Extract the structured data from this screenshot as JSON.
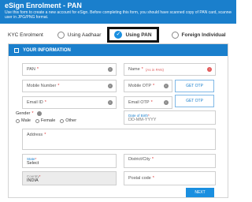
{
  "header": {
    "title": "eSign Enrolment - PAN",
    "subtitle_line1": "Use this form to create a new account for eSign. Before completing this form, you should have scanned copy of PAN card, scanned",
    "subtitle_line2": "user in JPG/PNG format."
  },
  "kyc": {
    "label": "KYC Enrolment",
    "options": [
      {
        "label": "Using Aadhaar",
        "selected": false
      },
      {
        "label": "Using PAN",
        "selected": true
      },
      {
        "label": "Foreign Individual",
        "selected": false
      }
    ]
  },
  "panel": {
    "title": "YOUR INFORMATION",
    "pan": {
      "label": "PAN",
      "req": "*"
    },
    "name": {
      "label": "Name",
      "req": "*",
      "note": "(As in PAN)"
    },
    "mobile": {
      "label": "Mobile Number",
      "req": "*"
    },
    "mobile_otp": {
      "label": "Mobile OTP",
      "req": "*"
    },
    "email": {
      "label": "Email ID",
      "req": "*"
    },
    "email_otp": {
      "label": "Email OTP",
      "req": "*"
    },
    "get_otp_label": "GET OTP",
    "gender": {
      "label": "Gender",
      "req": "*",
      "options": [
        "Male",
        "Female",
        "Other"
      ]
    },
    "dob": {
      "label": "Date of Birth",
      "req": "*",
      "placeholder": "DD-MM-YYYY"
    },
    "address": {
      "label": "Address",
      "req": "*"
    },
    "state": {
      "label": "State",
      "req": "*",
      "value": "Select"
    },
    "district": {
      "label": "District/City",
      "req": "*"
    },
    "country": {
      "label": "Country",
      "req": "*",
      "value": "INDIA"
    },
    "postal": {
      "label": "Postal code",
      "req": "*"
    },
    "next_label": "NEXT"
  },
  "colors": {
    "accent": "#1a7fcc",
    "required": "#d33333"
  }
}
